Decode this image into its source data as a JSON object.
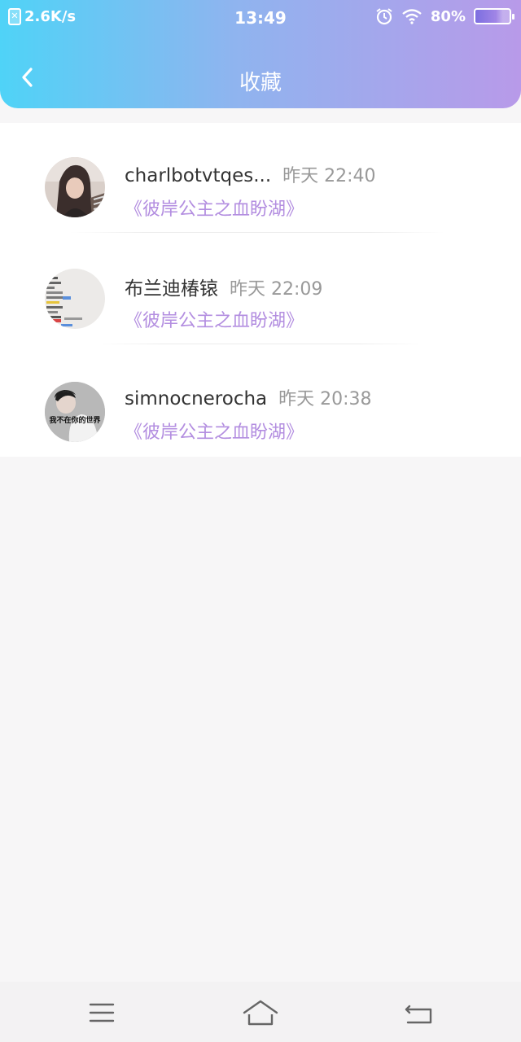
{
  "status_bar": {
    "network_speed": "2.6K/s",
    "time": "13:49",
    "battery": "80%"
  },
  "header": {
    "title": "收藏"
  },
  "items": [
    {
      "username": "charlbotvtqes...",
      "time": "昨天 22:40",
      "book": "《彼岸公主之血盼湖》"
    },
    {
      "username": "布兰迪椿锿",
      "time": "昨天 22:09",
      "book": "《彼岸公主之血盼湖》"
    },
    {
      "username": "simnocnerocha",
      "time": "昨天 20:38",
      "book": "《彼岸公主之血盼湖》"
    }
  ],
  "avatar3_caption": "我不在你的世界",
  "icons": {
    "back": "chevron-left-icon",
    "menu": "menu-icon",
    "home": "home-icon",
    "return": "return-icon"
  },
  "colors": {
    "gradient_start": "#4fd3f7",
    "gradient_end": "#b89ae9",
    "book_title": "#b38ee0",
    "time_text": "#999999"
  }
}
